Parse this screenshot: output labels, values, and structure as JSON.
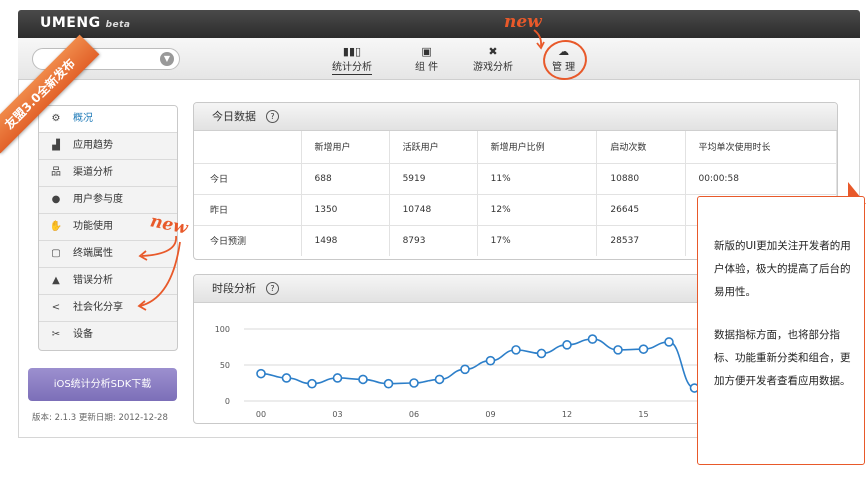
{
  "brand": {
    "logo": "UMENG",
    "tag": "beta"
  },
  "ribbon": "友盟3.0全新发布",
  "new_tags": [
    "new",
    "new"
  ],
  "nav": {
    "tabs": [
      {
        "label": "统计分析",
        "icon": "bar-chart-icon"
      },
      {
        "label": "组 件",
        "icon": "component-icon"
      },
      {
        "label": "游戏分析",
        "icon": "game-icon"
      },
      {
        "label": "管 理",
        "icon": "cloud-icon"
      }
    ]
  },
  "sidebar": {
    "items": [
      {
        "label": "概况",
        "icon": "overview-icon",
        "active": true
      },
      {
        "label": "应用趋势",
        "icon": "trend-icon"
      },
      {
        "label": "渠道分析",
        "icon": "channel-icon"
      },
      {
        "label": "用户参与度",
        "icon": "user-icon"
      },
      {
        "label": "功能使用",
        "icon": "feature-icon"
      },
      {
        "label": "终端属性",
        "icon": "device-icon"
      },
      {
        "label": "错误分析",
        "icon": "warning-icon"
      },
      {
        "label": "社会化分享",
        "icon": "share-icon"
      },
      {
        "label": "设备",
        "icon": "tools-icon"
      }
    ],
    "sdk_button": "iOS统计分析SDK下载",
    "version": "版本: 2.1.3 更新日期: 2012-12-28"
  },
  "today_panel": {
    "title": "今日数据",
    "help": "?",
    "columns": [
      "",
      "新增用户",
      "活跃用户",
      "新增用户比例",
      "启动次数",
      "平均单次使用时长"
    ],
    "rows": [
      [
        "今日",
        "688",
        "5919",
        "11%",
        "10880",
        "00:00:58"
      ],
      [
        "昨日",
        "1350",
        "10748",
        "12%",
        "26645",
        ""
      ],
      [
        "今日预测",
        "1498",
        "8793",
        "17%",
        "28537",
        ""
      ]
    ]
  },
  "chart_panel": {
    "title": "时段分析",
    "help": "?"
  },
  "chart_data": {
    "type": "line",
    "x_labels": [
      "00",
      "03",
      "06",
      "09",
      "12",
      "15"
    ],
    "x": [
      0,
      1,
      2,
      3,
      4,
      5,
      6,
      7,
      8,
      9,
      10,
      11,
      12,
      13,
      14,
      15,
      16,
      17
    ],
    "values": [
      38,
      32,
      24,
      32,
      30,
      24,
      25,
      30,
      44,
      56,
      71,
      66,
      78,
      86,
      71,
      72,
      82,
      18
    ],
    "yticks": [
      0,
      50,
      100
    ],
    "ylim": [
      0,
      100
    ],
    "line_color": "#2d7fc9",
    "grid": true
  },
  "callout": {
    "p1": "新版的UI更加关注开发者的用户体验，极大的提高了后台的易用性。",
    "p2": "数据指标方面，也将部分指标、功能重新分类和组合，更加方便开发者查看应用数据。"
  },
  "colors": {
    "accent": "#e8592a",
    "sdk_button": "#8a7ec4",
    "link_active": "#1e7ab8"
  }
}
